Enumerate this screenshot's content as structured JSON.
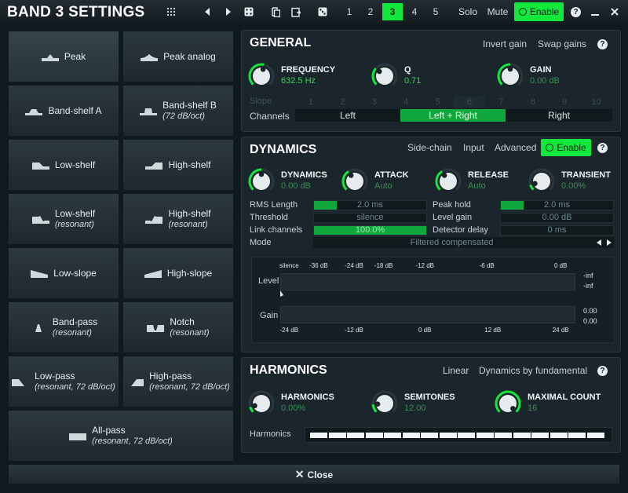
{
  "window": {
    "title": "BAND 3 SETTINGS"
  },
  "toolbar": {
    "bands": [
      "1",
      "2",
      "3",
      "4",
      "5"
    ],
    "active_band": "3",
    "solo": "Solo",
    "mute": "Mute",
    "enable": "Enable",
    "help": "?"
  },
  "shapes": [
    {
      "label": "Peak",
      "sub": ""
    },
    {
      "label": "Peak analog",
      "sub": ""
    },
    {
      "label": "Band-shelf A",
      "sub": ""
    },
    {
      "label": "Band-shelf B",
      "sub": "(72 dB/oct)"
    },
    {
      "label": "Low-shelf",
      "sub": ""
    },
    {
      "label": "High-shelf",
      "sub": ""
    },
    {
      "label": "Low-shelf",
      "sub": "(resonant)"
    },
    {
      "label": "High-shelf",
      "sub": "(resonant)"
    },
    {
      "label": "Low-slope",
      "sub": ""
    },
    {
      "label": "High-slope",
      "sub": ""
    },
    {
      "label": "Band-pass",
      "sub": "(resonant)"
    },
    {
      "label": "Notch",
      "sub": "(resonant)"
    },
    {
      "label": "Low-pass",
      "sub": "(resonant, 72 dB/oct)"
    },
    {
      "label": "High-pass",
      "sub": "(resonant, 72 dB/oct)"
    },
    {
      "label": "All-pass",
      "sub": "(resonant, 72 dB/oct)"
    }
  ],
  "general": {
    "title": "GENERAL",
    "invert_gain": "Invert gain",
    "swap_gains": "Swap gains",
    "help": "?",
    "frequency": {
      "label": "FREQUENCY",
      "value": "632.5 Hz",
      "level": 0.55
    },
    "q": {
      "label": "Q",
      "value": "0.71",
      "level": 0.32
    },
    "gain": {
      "label": "GAIN",
      "value": "0.00 dB",
      "level": 0.5
    },
    "slope_label": "Slope",
    "slope_values": [
      "1",
      "2",
      "3",
      "4",
      "5",
      "6",
      "7",
      "8",
      "9",
      "10"
    ],
    "channels_label": "Channels",
    "channels": [
      "Left",
      "Left + Right",
      "Right"
    ],
    "channel_selected": "Left + Right"
  },
  "dynamics": {
    "title": "DYNAMICS",
    "side_chain": "Side-chain",
    "input": "Input",
    "advanced": "Advanced",
    "enable": "Enable",
    "help": "?",
    "dyn": {
      "label": "DYNAMICS",
      "value": "0.00 dB",
      "level": 0.5
    },
    "attack": {
      "label": "ATTACK",
      "value": "Auto",
      "level": 0.38
    },
    "release": {
      "label": "RELEASE",
      "value": "Auto",
      "level": 0.38
    },
    "transient": {
      "label": "TRANSIENT",
      "value": "0.00%",
      "level": 0.1
    },
    "rms_length": {
      "label": "RMS Length",
      "value": "2.0 ms",
      "fill": 0.2
    },
    "threshold": {
      "label": "Threshold",
      "value": "silence",
      "fill": 0
    },
    "link_channels": {
      "label": "Link channels",
      "value": "100.0%",
      "fill": 1
    },
    "peak_hold": {
      "label": "Peak hold",
      "value": "2.0 ms",
      "fill": 0.2
    },
    "level_gain": {
      "label": "Level gain",
      "value": "0.00 dB",
      "fill": 0
    },
    "detector_delay": {
      "label": "Detector delay",
      "value": "0 ms",
      "fill": 0
    },
    "mode_label": "Mode",
    "mode_value": "Filtered compensated",
    "meter": {
      "top_scale": [
        "silence",
        "-36 dB",
        "-24 dB",
        "-18 dB",
        "-12 dB",
        "-6 dB",
        "0 dB"
      ],
      "bottom_scale": [
        "-24 dB",
        "-12 dB",
        "0 dB",
        "12 dB",
        "24 dB"
      ],
      "level_label": "Level",
      "gain_label": "Gain",
      "level_readouts": [
        "-inf",
        "-inf"
      ],
      "gain_readouts": [
        "0.00",
        "0.00"
      ]
    }
  },
  "harmonics": {
    "title": "HARMONICS",
    "linear": "Linear",
    "by_fundamental": "Dynamics by fundamental",
    "help": "?",
    "harmonics": {
      "label": "HARMONICS",
      "value": "0.00%",
      "level": 0.1
    },
    "semitones": {
      "label": "SEMITONES",
      "value": "12.00",
      "level": 0.15
    },
    "maximal_count": {
      "label": "MAXIMAL COUNT",
      "value": "16",
      "level": 1
    },
    "row_label": "Harmonics",
    "cells": 16
  },
  "close": {
    "label": "Close"
  }
}
